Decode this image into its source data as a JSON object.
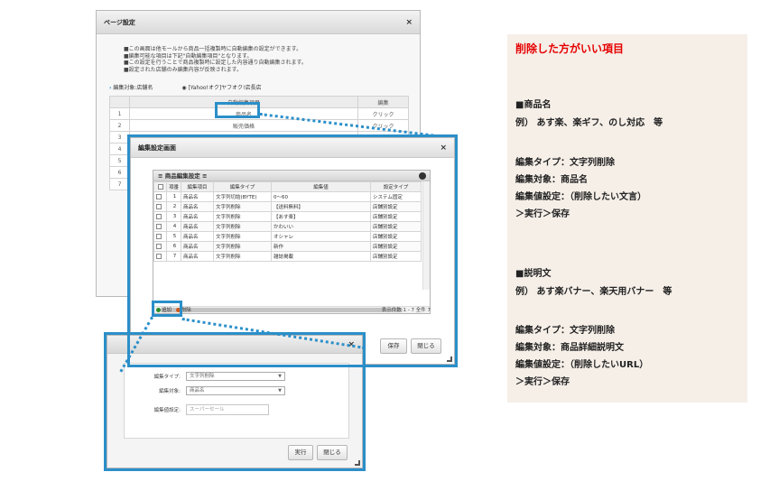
{
  "page_settings_dialog": {
    "title": "ページ設定",
    "close": "×",
    "notice_lines": [
      "■この画面は他モールから商品一括複製時に自動編集の設定ができます。",
      "■編集可能な項目は下記\"自動編集項目\"となります。",
      "■この設定を行うことで商品複製時に設定した内容通り自動編集されます。",
      "■設定された店舗のみ編集内容が反映されます。"
    ],
    "target_label": "編集対象:店舗名",
    "target_store": "[Yahoo!オク]ヤフオク!店長店",
    "table_headers": [
      "自動編集項目",
      "編集"
    ],
    "rows": [
      {
        "no": "1",
        "item": "商品名",
        "action": "クリック"
      },
      {
        "no": "2",
        "item": "販売価格",
        "action": "クリック"
      },
      {
        "no": "3",
        "item": "",
        "action": ""
      },
      {
        "no": "4",
        "item": "",
        "action": ""
      },
      {
        "no": "5",
        "item": "",
        "action": ""
      },
      {
        "no": "6",
        "item": "",
        "action": ""
      },
      {
        "no": "7",
        "item": "",
        "action": ""
      }
    ]
  },
  "edit_dialog": {
    "title": "編集設定画面",
    "close": "×",
    "grid_title": "≡ 商品編集設定 ≡",
    "columns": [
      "項番",
      "編集項目",
      "編集タイプ",
      "編集値",
      "設定タイプ"
    ],
    "rows": [
      {
        "no": "1",
        "item": "商品名",
        "type": "文字列切詰(BYTE)",
        "value": "0〜60",
        "setting": "システム固定"
      },
      {
        "no": "2",
        "item": "商品名",
        "type": "文字列削除",
        "value": "【送料無料】",
        "setting": "店舗別設定"
      },
      {
        "no": "3",
        "item": "商品名",
        "type": "文字列削除",
        "value": "【あす楽】",
        "setting": "店舗別設定"
      },
      {
        "no": "4",
        "item": "商品名",
        "type": "文字列削除",
        "value": "かわいい",
        "setting": "店舗別設定"
      },
      {
        "no": "5",
        "item": "商品名",
        "type": "文字列削除",
        "value": "オシャレ",
        "setting": "店舗別設定"
      },
      {
        "no": "6",
        "item": "商品名",
        "type": "文字列削除",
        "value": "新作",
        "setting": "店舗別設定"
      },
      {
        "no": "7",
        "item": "商品名",
        "type": "文字列削除",
        "value": "雑誌掲載",
        "setting": "店舗別設定"
      }
    ],
    "add_label": "追加",
    "delete_label": "削除",
    "count_text": "表示件数 1 - 7 全件 7",
    "save_label": "保存",
    "close_label": "閉じる"
  },
  "exec_dialog": {
    "close": "×",
    "type_label": "編集タイプ:",
    "type_value": "文字列削除",
    "target_label": "編集対象:",
    "target_value": "商品名",
    "value_label": "編集値設定:",
    "value_placeholder": "スーパーセール",
    "exec_label": "実行",
    "close_label": "閉じる"
  },
  "note_panel": {
    "heading": "削除した方がいい項目",
    "section1_title": "■商品名",
    "section1_example": "例） あす楽、楽ギフ、のし対応　等",
    "section1_lines": [
      "編集タイプ：文字列削除",
      "編集対象：商品名",
      "編集値設定：（削除したい文言）",
      "＞実行＞保存"
    ],
    "section2_title": "■説明文",
    "section2_example": "例） あす楽バナー、楽天用バナー　等",
    "section2_lines": [
      "編集タイプ：文字列削除",
      "編集対象：商品詳細説明文",
      "編集値設定：（削除したいURL）",
      "＞実行＞保存"
    ]
  },
  "colors": {
    "highlight": "#2b8fc9",
    "heading_red": "#e60000",
    "note_bg": "#f5efe8"
  }
}
